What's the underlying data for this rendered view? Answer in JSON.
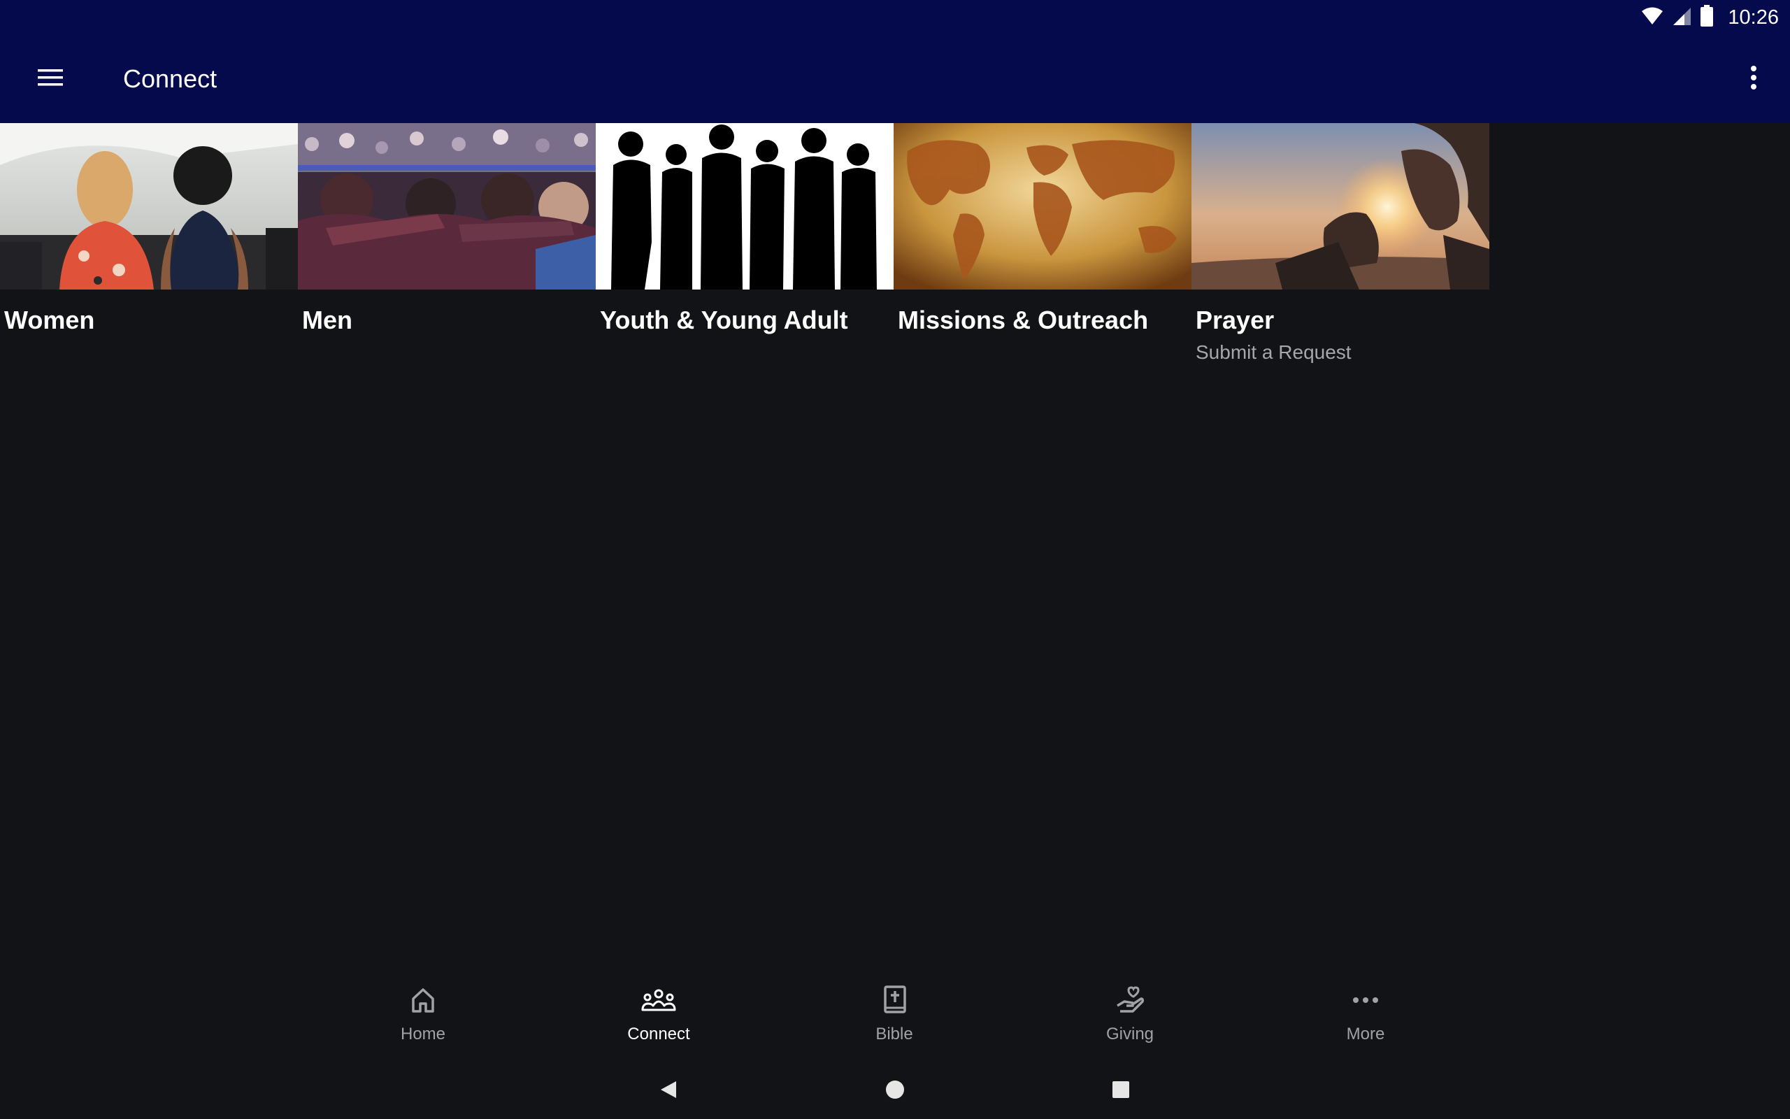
{
  "status_bar": {
    "time": "10:26"
  },
  "app_bar": {
    "title": "Connect"
  },
  "tiles": [
    {
      "title": "Women",
      "subtitle": ""
    },
    {
      "title": "Men",
      "subtitle": ""
    },
    {
      "title": "Youth & Young Adult",
      "subtitle": ""
    },
    {
      "title": "Missions & Outreach",
      "subtitle": ""
    },
    {
      "title": "Prayer",
      "subtitle": "Submit a Request"
    }
  ],
  "bottom_nav": {
    "items": [
      {
        "label": "Home",
        "icon": "home-icon"
      },
      {
        "label": "Connect",
        "icon": "people-icon",
        "active": true
      },
      {
        "label": "Bible",
        "icon": "bible-icon"
      },
      {
        "label": "Giving",
        "icon": "giving-icon"
      },
      {
        "label": "More",
        "icon": "more-horizontal-icon"
      }
    ]
  },
  "colors": {
    "app_bar": "#040a4c",
    "background": "#121316",
    "nav_inactive": "#a0a2a6"
  }
}
